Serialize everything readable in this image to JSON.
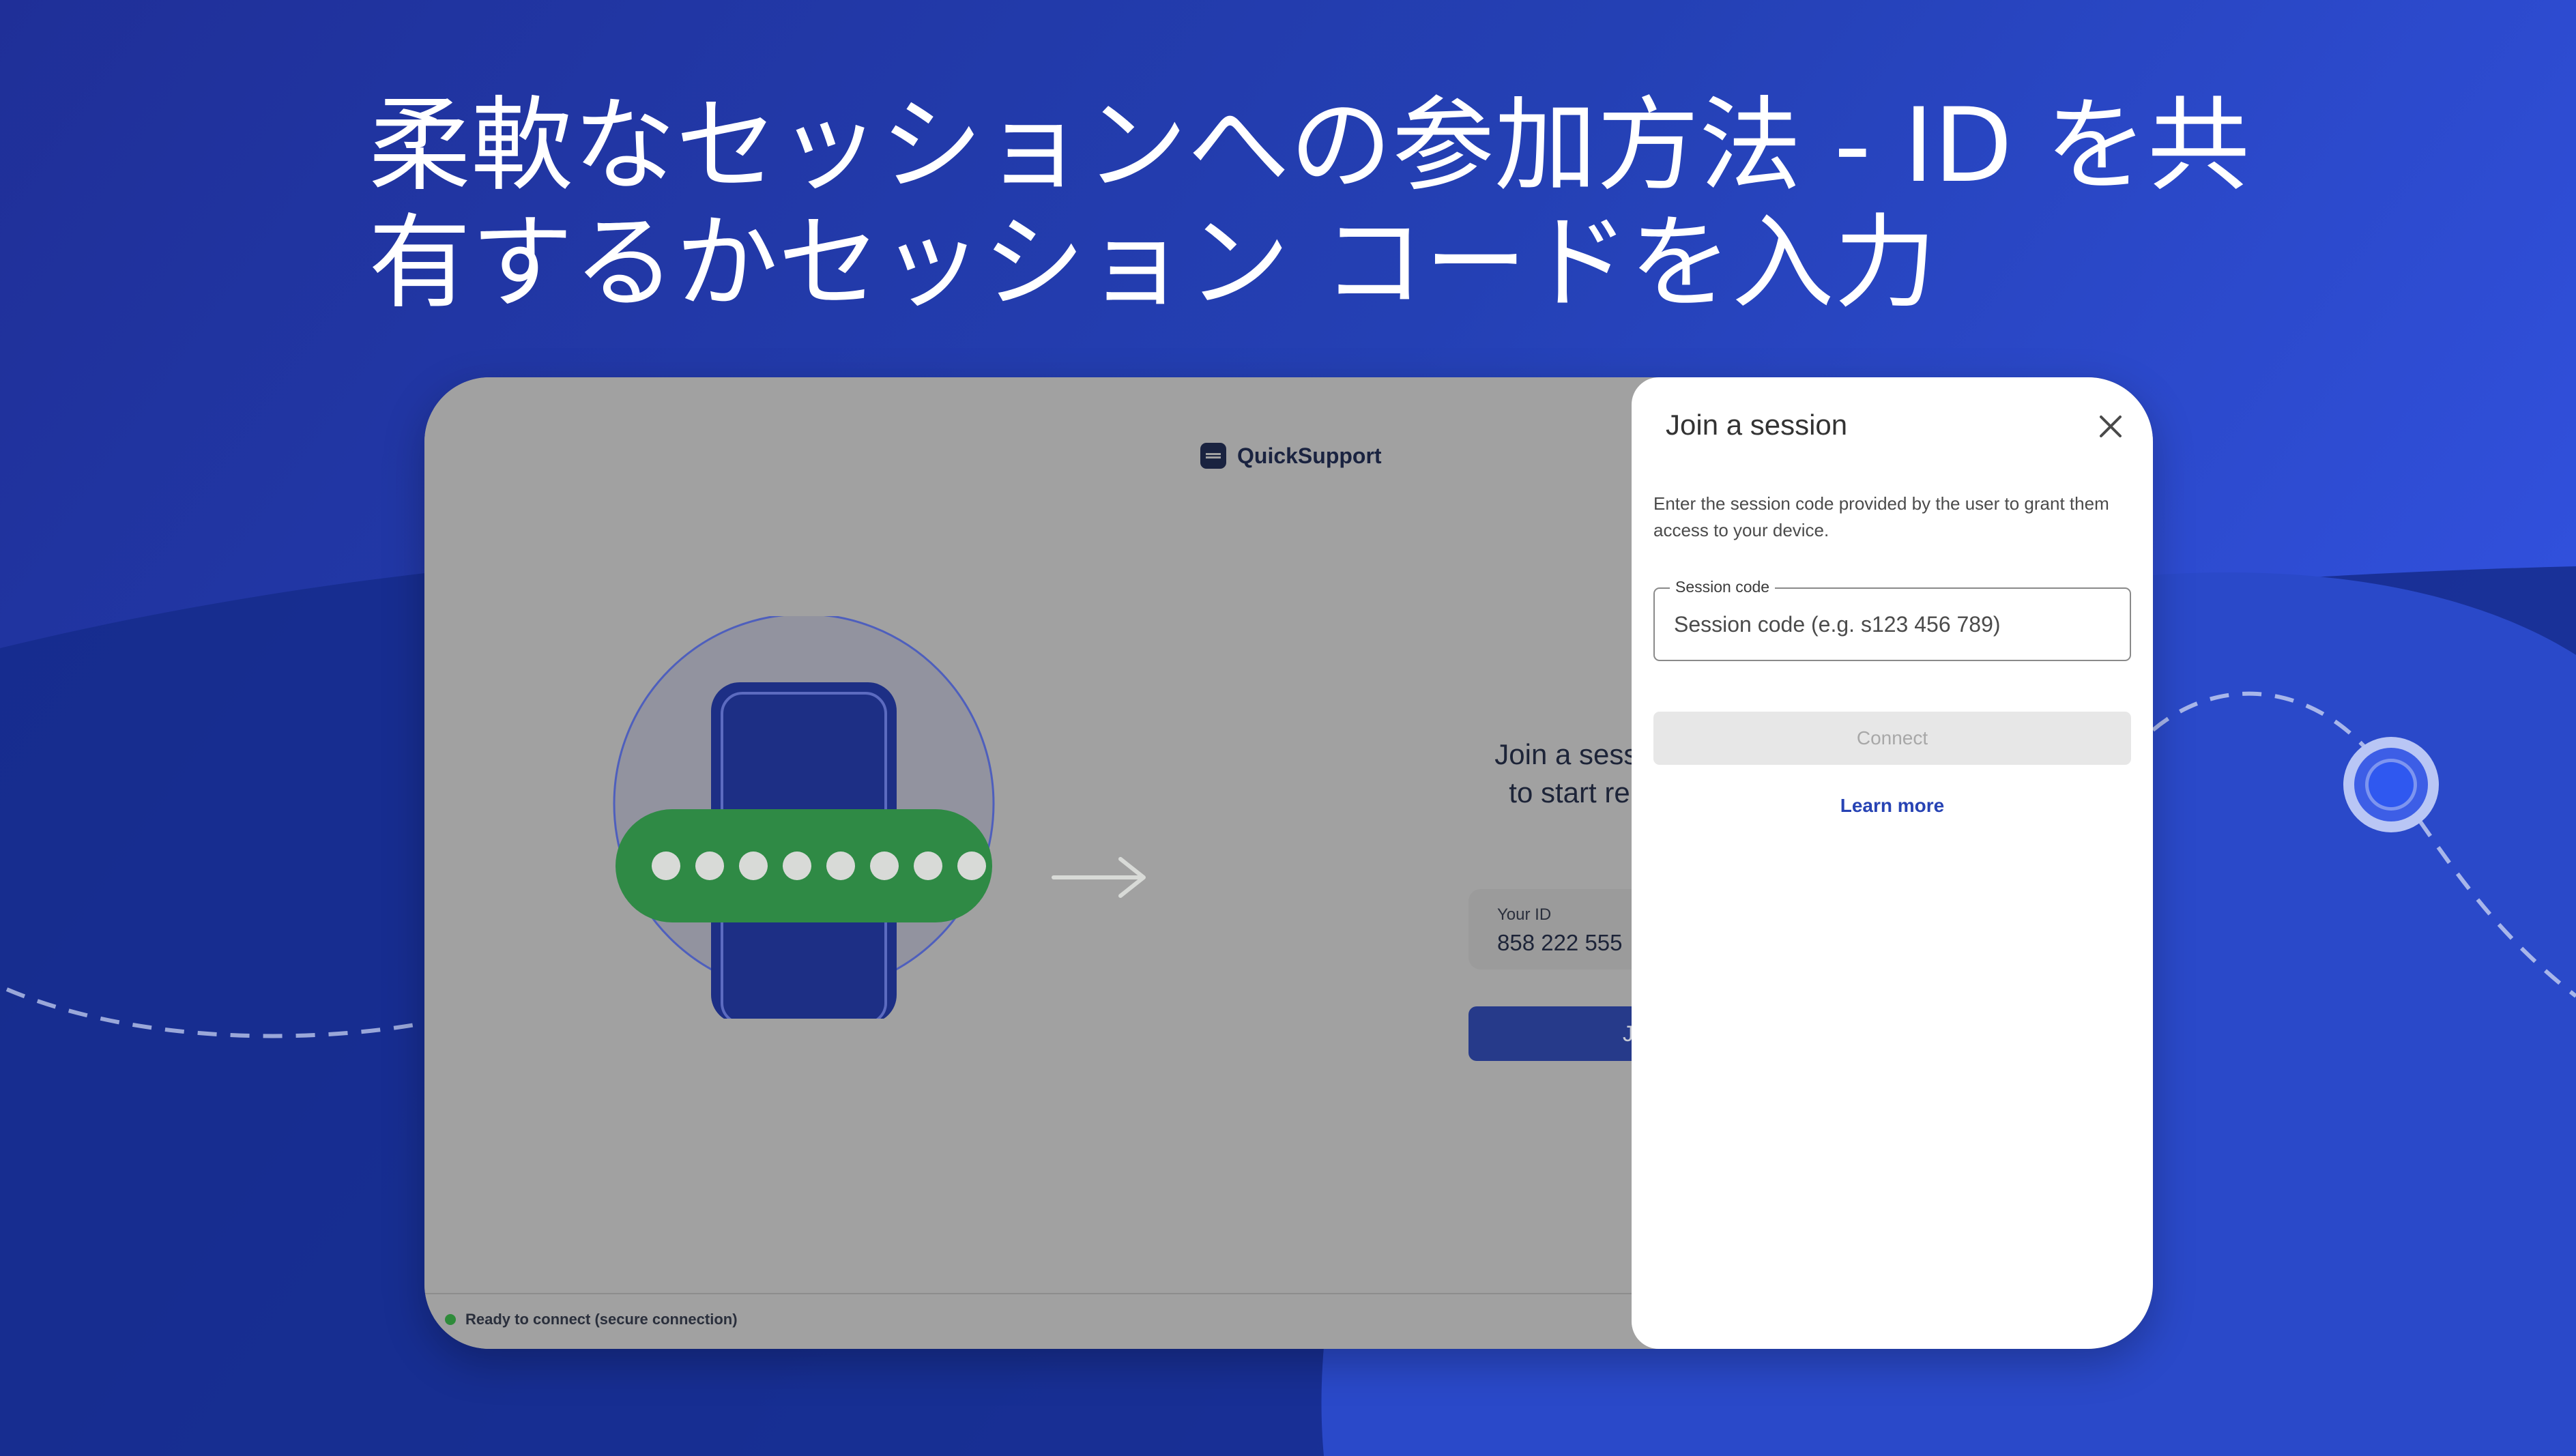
{
  "headline": {
    "line1": "柔軟なセッションへの参加方法 - ID を共",
    "line2": "有するかセッション コードを入力"
  },
  "app": {
    "brand_name": "QuickSupport",
    "side_text": "Join a sessi\nto start re",
    "id_label": "Your ID",
    "id_value": "858 222 555",
    "join_button_label": "J",
    "status_text": "Ready to connect (secure connection)"
  },
  "dialog": {
    "title": "Join a session",
    "description": "Enter the session code provided by the user to grant them access to your device.",
    "field_label": "Session code",
    "field_placeholder": "Session code (e.g. s123 456 789)",
    "field_value": "",
    "connect_label": "Connect",
    "learn_more_label": "Learn more"
  },
  "colors": {
    "background": "#2338a6",
    "panel": "#ffffff",
    "link": "#2743b4",
    "status_ok": "#2e8b3a",
    "pill": "#2f8a45"
  },
  "icons": {
    "close": "close-icon",
    "brand": "quicksupport-logo-icon",
    "arrow": "arrow-right-icon",
    "status": "status-dot-icon"
  }
}
